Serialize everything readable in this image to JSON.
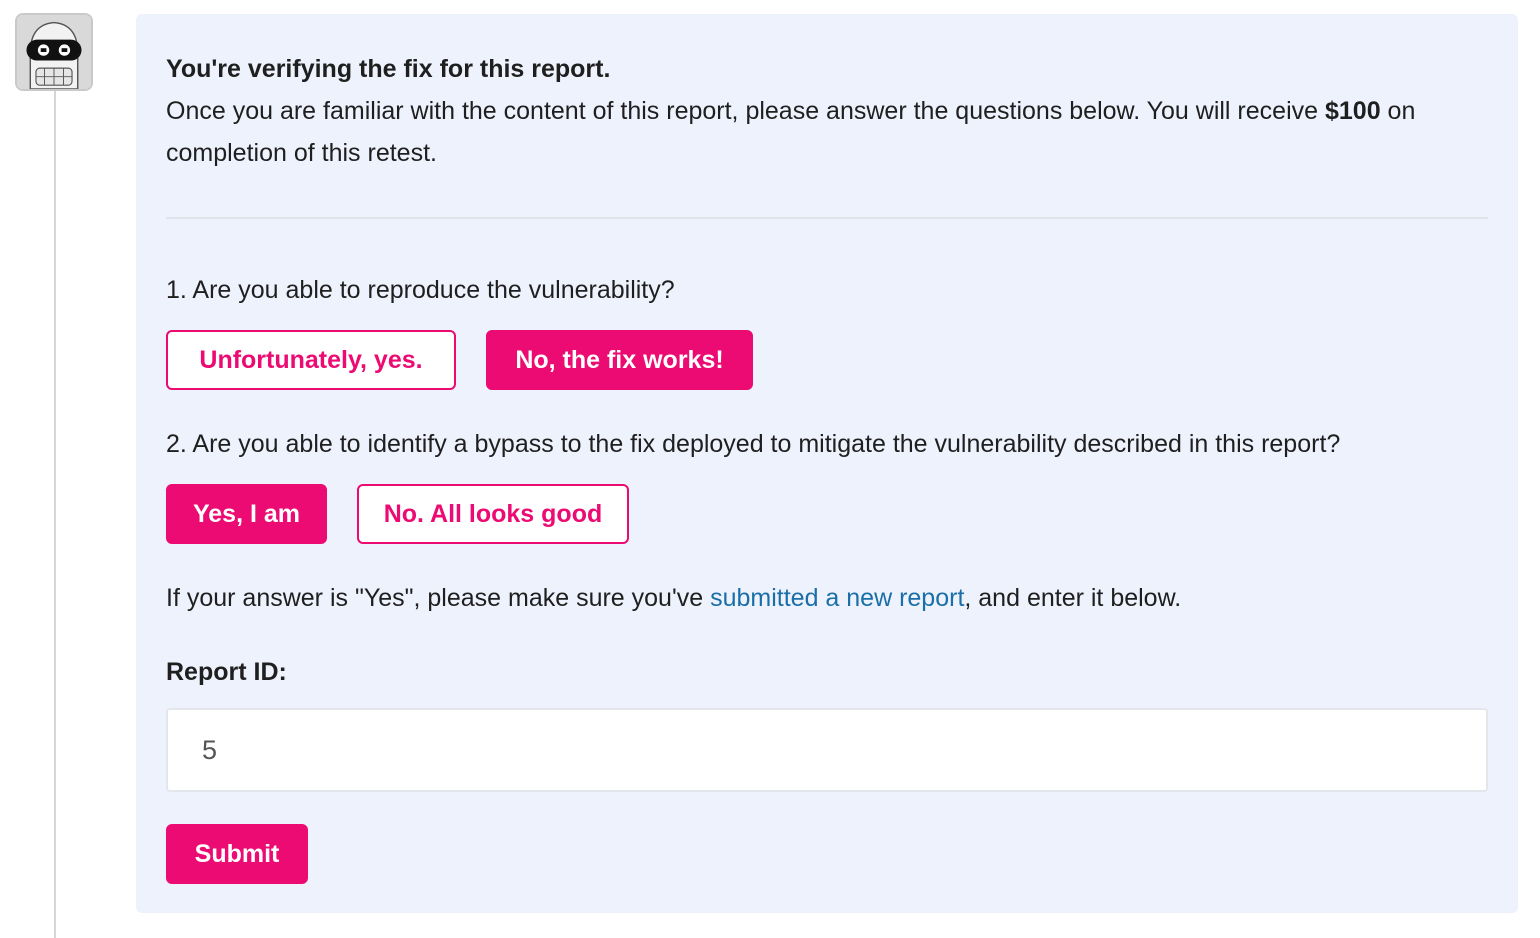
{
  "avatar": {
    "icon": "robot-avatar-icon"
  },
  "intro": {
    "heading": "You're verifying the fix for this report.",
    "text_before_amount": "Once you are familiar with the content of this report, please answer the questions below. You will receive ",
    "amount": "$100",
    "text_after_amount": " on completion of this retest."
  },
  "question1": {
    "text": "1. Are you able to reproduce the vulnerability?",
    "option_yes": "Unfortunately, yes.",
    "option_no": "No, the fix works!",
    "selected": "option_no"
  },
  "question2": {
    "text": "2. Are you able to identify a bypass to the fix deployed to mitigate the vulnerability described in this report?",
    "option_yes": "Yes, I am",
    "option_no": "No. All looks good",
    "selected": "option_yes"
  },
  "hint": {
    "before": "If your answer is \"Yes\", please make sure you've ",
    "link": "submitted a new report",
    "after": ", and enter it below."
  },
  "report": {
    "label": "Report ID:",
    "value": "5"
  },
  "submit_label": "Submit",
  "colors": {
    "accent": "#ec0b72",
    "card_background": "#eef2fc",
    "link": "#1a6fa8"
  }
}
